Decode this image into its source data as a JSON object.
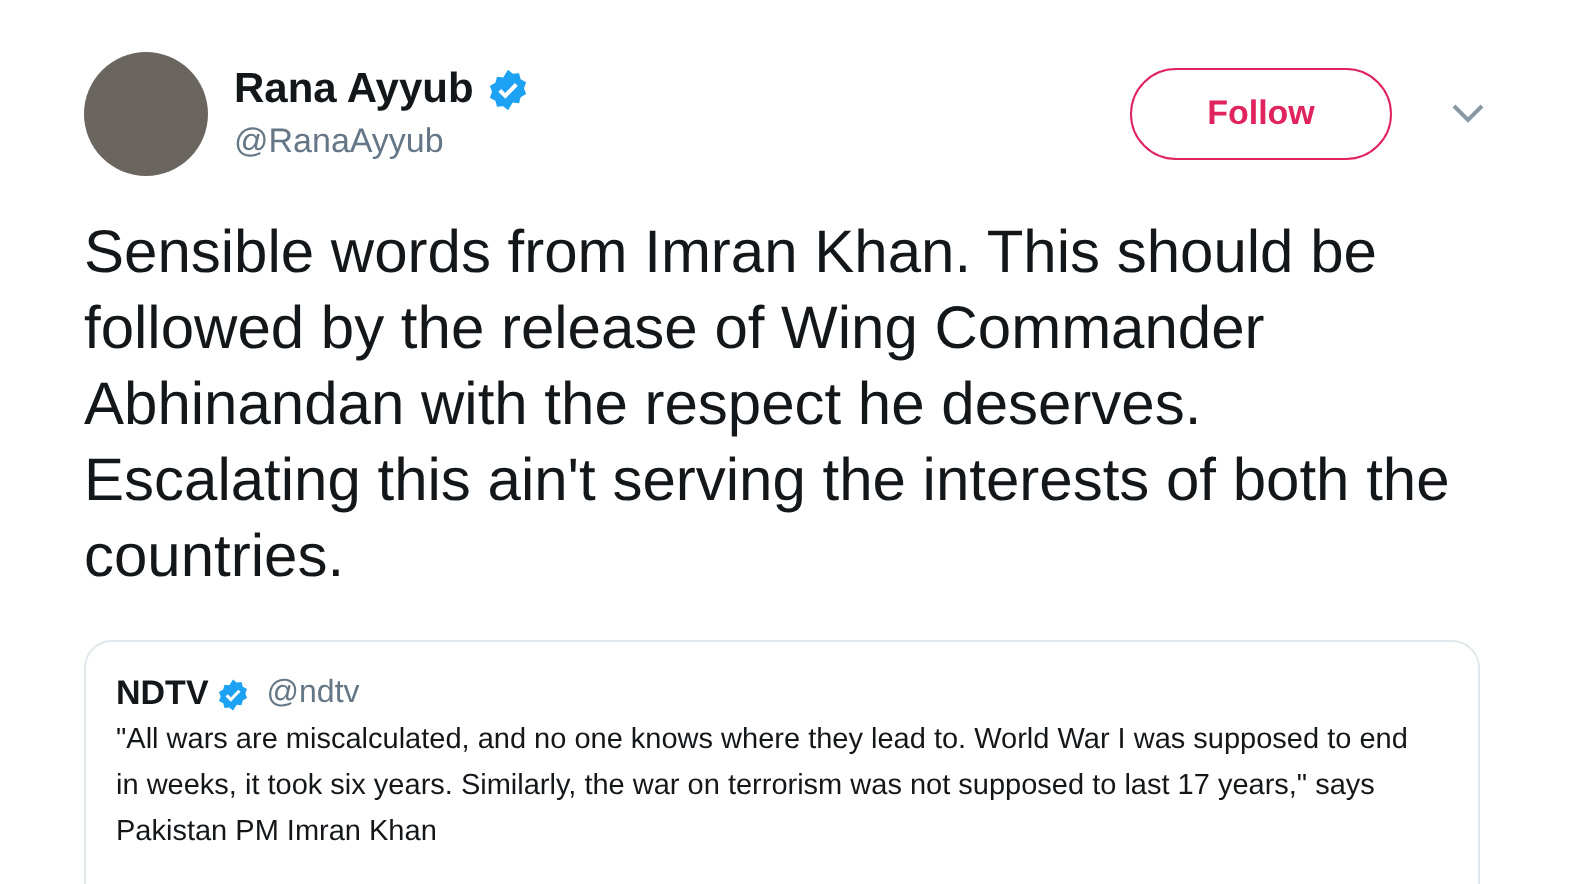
{
  "author": {
    "name": "Rana Ayyub",
    "verified": true,
    "handle": "@RanaAyyub"
  },
  "follow_button": {
    "label": "Follow"
  },
  "tweet_text": "Sensible words from Imran Khan. This should be followed by the release of Wing Commander Abhinandan with the respect he deserves. Escalating this ain't serving the interests of both the countries.",
  "quoted_tweet": {
    "name": "NDTV",
    "verified": true,
    "handle": "@ndtv",
    "text": "\"All wars are miscalculated, and no one knows where they lead to. World War I was supposed to end in weeks, it took six years. Similarly, the war on terrorism was not supposed to last 17 years,\" says Pakistan PM Imran Khan"
  }
}
